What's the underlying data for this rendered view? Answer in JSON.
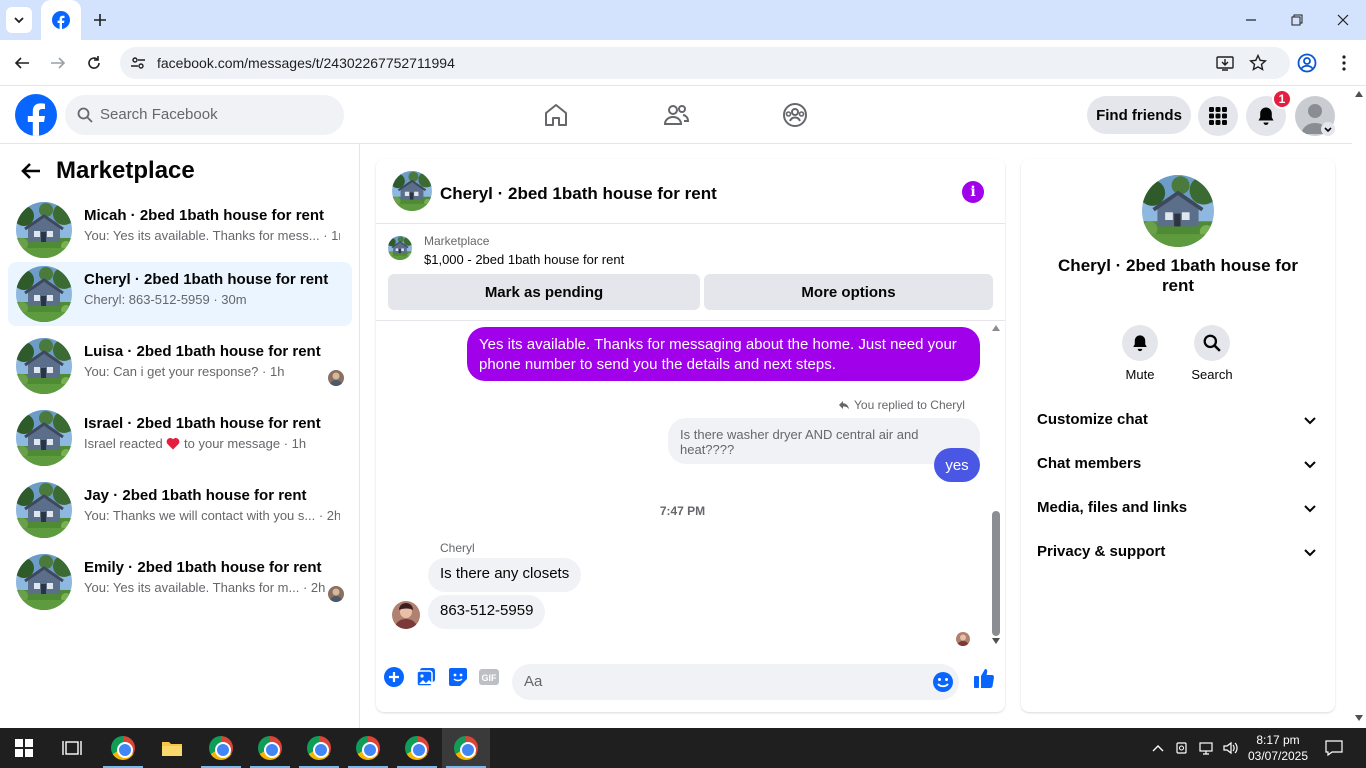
{
  "browser": {
    "url": "facebook.com/messages/t/24302267752711994"
  },
  "facebook": {
    "search_placeholder": "Search Facebook",
    "find_friends": "Find friends",
    "notifications_count": "1"
  },
  "left": {
    "title": "Marketplace",
    "conversations": [
      {
        "name": "Micah · 2bed 1bath house for rent",
        "preview": "You: Yes its available. Thanks for mess... · 1m",
        "active": false
      },
      {
        "name": "Cheryl · 2bed 1bath house for rent",
        "preview": "Cheryl: 863-512-5959 · 30m",
        "active": true
      },
      {
        "name": "Luisa · 2bed 1bath house for rent",
        "preview": "You: Can i get your response? · 1h",
        "active": false
      },
      {
        "name": "Israel · 2bed 1bath house for rent",
        "preview_a": "Israel reacted",
        "preview_b": "to your message · 1h",
        "active": false
      },
      {
        "name": "Jay · 2bed 1bath house for rent",
        "preview": "You: Thanks we will contact with you s... · 2h",
        "active": false
      },
      {
        "name": "Emily · 2bed 1bath house for rent",
        "preview": "You: Yes its available. Thanks for m... · 2h",
        "active": false
      }
    ]
  },
  "chat": {
    "title": "Cheryl · 2bed 1bath house for rent",
    "marketplace_label": "Marketplace",
    "listing": "$1,000 - 2bed 1bath house for rent",
    "mark_pending": "Mark as pending",
    "more_options": "More options",
    "messages": {
      "out1": "Yes its available. Thanks for messaging about the home. Just need your phone number to send you the details and next steps.",
      "replied_to": "You replied to Cheryl",
      "quoted": "Is there washer dryer AND central air and heat????",
      "out2": "yes",
      "timestamp": "7:47 PM",
      "sender": "Cheryl",
      "in1": "Is there any closets",
      "in2": "863-512-5959"
    },
    "composer_placeholder": "Aa"
  },
  "right": {
    "title": "Cheryl · 2bed 1bath house for rent",
    "mute": "Mute",
    "search": "Search",
    "sections": [
      "Customize chat",
      "Chat members",
      "Media, files and links",
      "Privacy & support"
    ]
  },
  "taskbar": {
    "time": "8:17 pm",
    "date": "03/07/2025"
  },
  "colors": {
    "fb_blue": "#0866ff",
    "messenger_purple": "#a100ea",
    "reply_blue": "#4a57e5"
  }
}
